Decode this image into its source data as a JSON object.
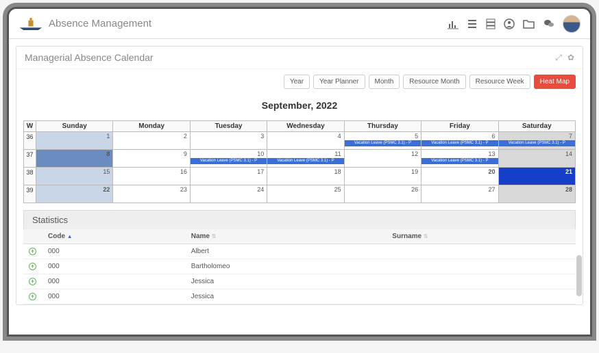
{
  "header": {
    "app_title": "Absence Management",
    "icons": [
      "bar-chart-icon",
      "list-icon",
      "server-icon",
      "user-circle-icon",
      "folder-open-icon",
      "chat-icon"
    ]
  },
  "panel": {
    "title": "Managerial Absence Calendar"
  },
  "view_buttons": [
    {
      "label": "Year",
      "active": false
    },
    {
      "label": "Year Planner",
      "active": false
    },
    {
      "label": "Month",
      "active": false
    },
    {
      "label": "Resource Month",
      "active": false
    },
    {
      "label": "Resource Week",
      "active": false
    },
    {
      "label": "Heat Map",
      "active": true
    }
  ],
  "calendar": {
    "title": "September, 2022",
    "week_col": "W",
    "days": [
      "Sunday",
      "Monday",
      "Tuesday",
      "Wednesday",
      "Thursday",
      "Friday",
      "Saturday"
    ],
    "weeks": [
      {
        "num": "36",
        "cells": [
          {
            "d": "1",
            "shade": "shade1"
          },
          {
            "d": "2"
          },
          {
            "d": "3"
          },
          {
            "d": "4"
          },
          {
            "d": "5",
            "event": "Vacation Leave (PSMC 3.1) - P"
          },
          {
            "d": "6",
            "event": "Vacation Leave (PSMC 3.1) - P"
          },
          {
            "d": "7",
            "shade": "shade3",
            "event": "Vacation Leave (PSMC 3.1) - P"
          }
        ]
      },
      {
        "num": "37",
        "cells": [
          {
            "d": "8",
            "shade": "shade2",
            "bold": true
          },
          {
            "d": "9"
          },
          {
            "d": "10",
            "event": "Vacation Leave (PSMC 3.1) - P"
          },
          {
            "d": "11",
            "event": "Vacation Leave (PSMC 3.1) - P"
          },
          {
            "d": "12"
          },
          {
            "d": "13",
            "event": "Vacation Leave (PSMC 3.1) - P"
          },
          {
            "d": "14",
            "shade": "shade3"
          }
        ]
      },
      {
        "num": "38",
        "cells": [
          {
            "d": "15",
            "shade": "shade1"
          },
          {
            "d": "16"
          },
          {
            "d": "17"
          },
          {
            "d": "18"
          },
          {
            "d": "19"
          },
          {
            "d": "20",
            "bold": true
          },
          {
            "d": "21",
            "shade": "shade4",
            "bold": true
          }
        ]
      },
      {
        "num": "39",
        "cells": [
          {
            "d": "22",
            "shade": "shade1",
            "bold": true
          },
          {
            "d": "23"
          },
          {
            "d": "24"
          },
          {
            "d": "25"
          },
          {
            "d": "26"
          },
          {
            "d": "27"
          },
          {
            "d": "28",
            "shade": "shade3",
            "bold": true
          }
        ]
      }
    ]
  },
  "statistics": {
    "title": "Statistics",
    "columns": {
      "code": "Code",
      "name": "Name",
      "surname": "Surname"
    },
    "rows": [
      {
        "code": "000",
        "name": "Albert",
        "surname": ""
      },
      {
        "code": "000",
        "name": "Bartholomeo",
        "surname": ""
      },
      {
        "code": "000",
        "name": "Jessica",
        "surname": ""
      },
      {
        "code": "000",
        "name": "Jessica",
        "surname": ""
      }
    ]
  }
}
